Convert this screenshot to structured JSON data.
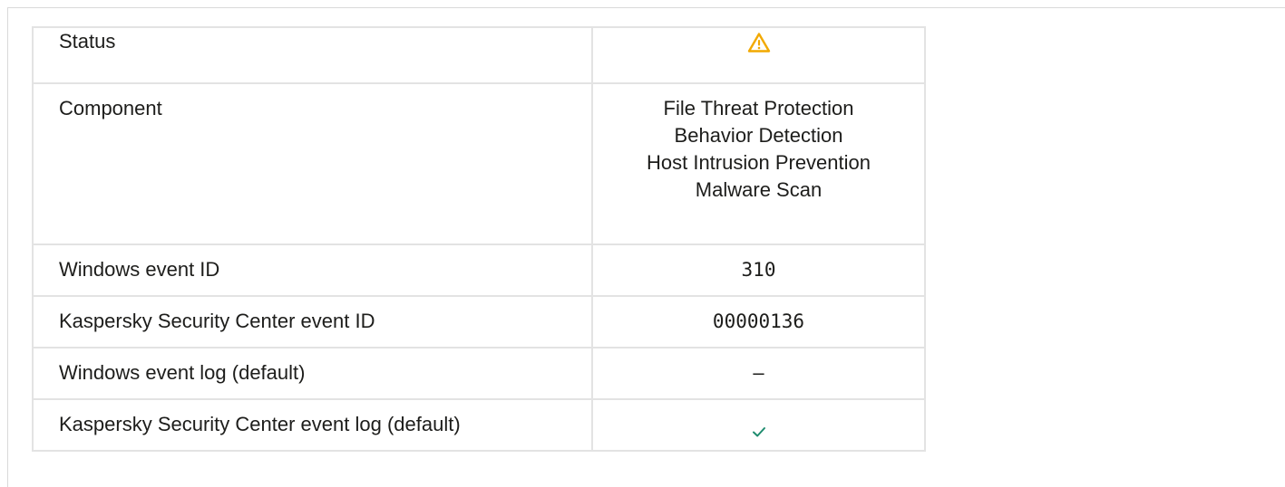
{
  "rows": [
    {
      "label": "Status",
      "value_icon": "warning-icon",
      "value_color": "#f2a900"
    },
    {
      "label": "Component",
      "values": [
        "File Threat Protection",
        "Behavior Detection",
        "Host Intrusion Prevention",
        "Malware Scan"
      ]
    },
    {
      "label": "Windows event ID",
      "value": "310"
    },
    {
      "label": "Kaspersky Security Center event ID",
      "value": "00000136"
    },
    {
      "label": "Windows event log (default)",
      "value": "–"
    },
    {
      "label": "Kaspersky Security Center event log (default)",
      "value_icon": "checkmark-icon",
      "value_color": "#1f8c6f"
    }
  ]
}
